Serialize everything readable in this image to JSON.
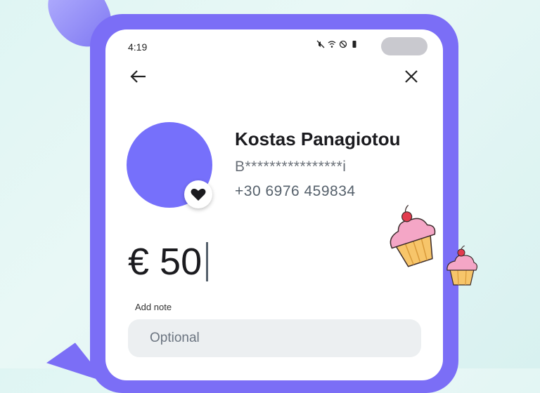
{
  "status_bar": {
    "time": "4:19",
    "icons": [
      "mute-icon",
      "wifi-icon",
      "do-not-disturb-icon",
      "battery-icon"
    ]
  },
  "header": {
    "back_icon": "arrow-left-icon",
    "close_icon": "close-icon"
  },
  "recipient": {
    "name": "Kostas Panagiotou",
    "iban_masked": "B****************i",
    "phone": "+30 6976 459834",
    "favorite_icon": "heart-icon",
    "avatar_color": "#7670fb"
  },
  "payment": {
    "amount": "€ 50"
  },
  "note": {
    "label": "Add note",
    "placeholder": "Optional"
  },
  "colors": {
    "accent": "#7b6ef6",
    "background": "#dff5f3"
  },
  "decorations": [
    "cupcake-icon",
    "cupcake-icon"
  ]
}
